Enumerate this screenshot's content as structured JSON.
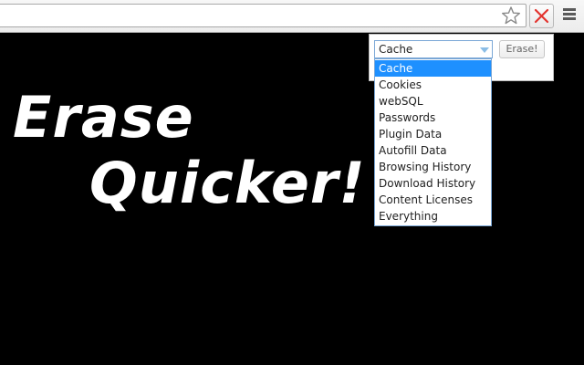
{
  "browser": {
    "address_value": "",
    "extension_icon": "close-x-icon",
    "star_icon": "star-icon",
    "menu_icon": "hamburger-menu-icon",
    "accent_red": "#e3342f"
  },
  "hero": {
    "line1": "Erase",
    "line2": "Quicker!"
  },
  "popup": {
    "selected_value": "Cache",
    "erase_label": "Erase!",
    "options": [
      "Cache",
      "Cookies",
      "webSQL",
      "Passwords",
      "Plugin Data",
      "Autofill Data",
      "Browsing History",
      "Download History",
      "Content Licenses",
      "Everything"
    ],
    "highlight_color": "#1e90ff"
  }
}
